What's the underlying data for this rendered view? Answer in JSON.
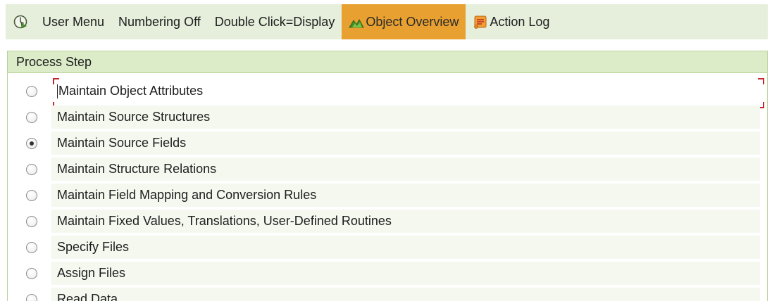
{
  "toolbar": {
    "execute_icon": "clock-execute-icon",
    "items": [
      {
        "label": "User Menu"
      },
      {
        "label": "Numbering Off"
      },
      {
        "label": "Double Click=Display"
      },
      {
        "label": "Object Overview",
        "icon": "mountain-chart-icon",
        "active": true
      },
      {
        "label": "Action Log",
        "icon": "scroll-log-icon"
      }
    ],
    "active_color": "#e8a030",
    "background_color": "#e6efdc"
  },
  "panel": {
    "title": "Process Step",
    "header_color": "#dcecc8",
    "steps": [
      {
        "label": "Maintain Object Attributes",
        "selected": false,
        "focused": true
      },
      {
        "label": "Maintain Source Structures",
        "selected": false
      },
      {
        "label": "Maintain Source Fields",
        "selected": true
      },
      {
        "label": "Maintain Structure Relations",
        "selected": false
      },
      {
        "label": "Maintain Field Mapping and Conversion Rules",
        "selected": false
      },
      {
        "label": "Maintain Fixed Values, Translations, User-Defined Routines",
        "selected": false
      },
      {
        "label": "Specify Files",
        "selected": false
      },
      {
        "label": "Assign Files",
        "selected": false
      },
      {
        "label": "Read Data",
        "selected": false
      }
    ]
  }
}
